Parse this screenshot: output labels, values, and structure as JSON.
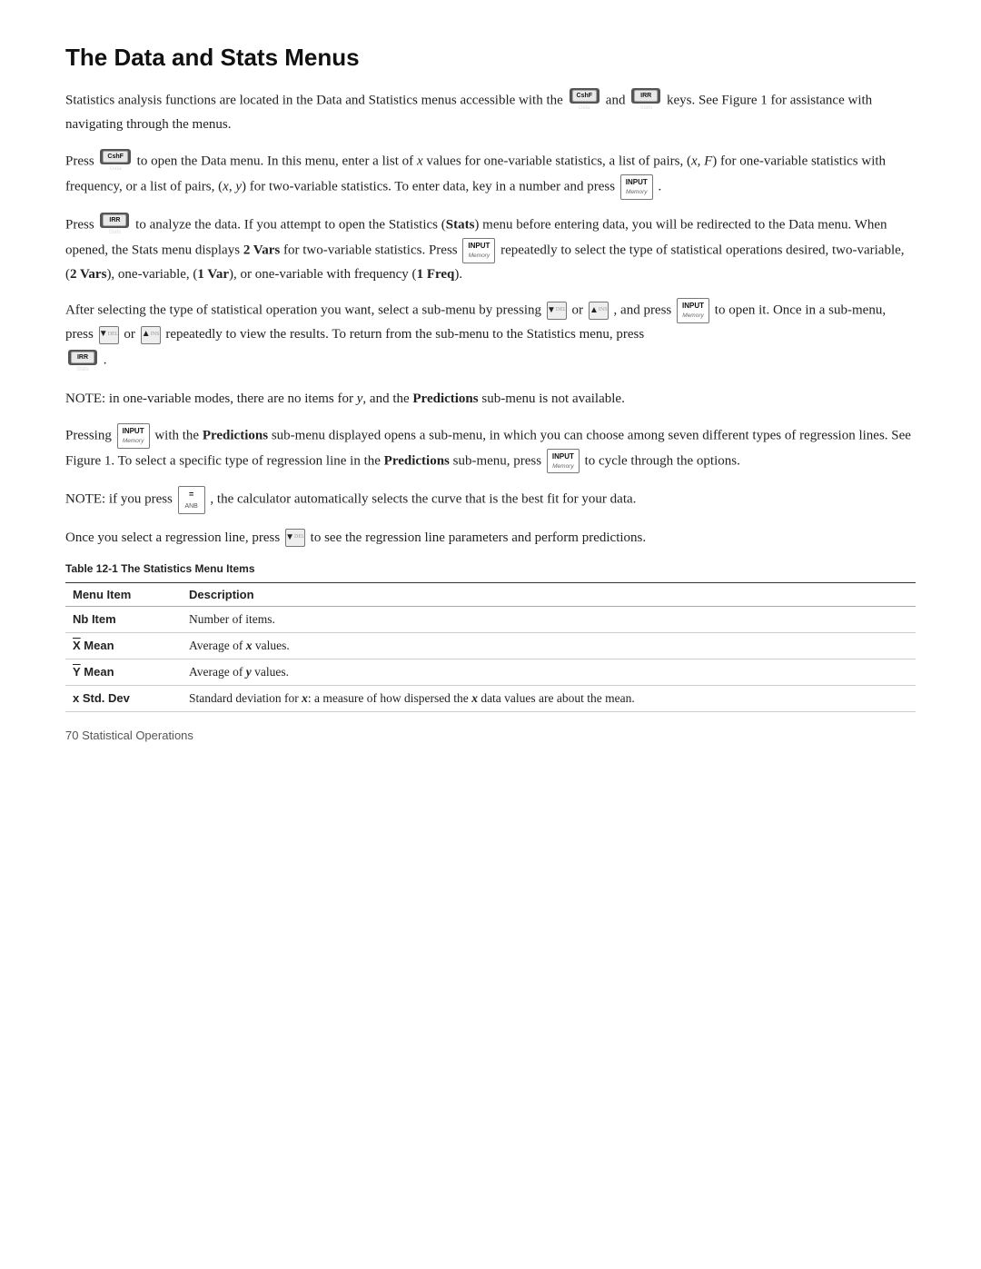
{
  "page": {
    "title": "The Data and Stats Menus",
    "paragraphs": [
      {
        "id": "p1",
        "text": "Statistics analysis functions are located in the Data and Statistics menus accessible with the"
      },
      {
        "id": "p1b",
        "text": "keys. See Figure 1 for assistance with navigating through the menus."
      },
      {
        "id": "p2a",
        "text": "Press"
      },
      {
        "id": "p2b",
        "text": "to open the Data menu. In this menu, enter a list of"
      },
      {
        "id": "p2c",
        "text": "values for one-variable statistics, a list of pairs, ("
      },
      {
        "id": "p2d",
        "text": ") for one-variable statistics with frequency, or a list of pairs, ("
      },
      {
        "id": "p2e",
        "text": ") for two-variable statistics. To enter data, key in a number and press"
      },
      {
        "id": "p3a",
        "text": "Press"
      },
      {
        "id": "p3b",
        "text": "to analyze the data. If you attempt to open the Statistics (Stats) menu before entering data, you will be redirected to the Data menu. When opened, the Stats menu displays 2 Vars for two-variable statistics. Press"
      },
      {
        "id": "p3c",
        "text": "repeatedly to select the type of statistical operations desired, two-variable, (2 Vars), one-variable, (1 Var), or one-variable with frequency (1 Freq)."
      },
      {
        "id": "p4a",
        "text": "After selecting the type of statistical operation you want, select a sub-menu by pressing"
      },
      {
        "id": "p4b",
        "text": "or"
      },
      {
        "id": "p4c",
        "text": ", and press"
      },
      {
        "id": "p4d",
        "text": "to open it. Once in a sub-menu, press"
      },
      {
        "id": "p4e",
        "text": "or"
      },
      {
        "id": "p4f",
        "text": "repeatedly to view the results. To return from the sub-menu to the Statistics menu, press"
      },
      {
        "id": "p5",
        "text": "NOTE:  in one-variable modes, there are no items for y, and the Predictions sub-menu is not available."
      },
      {
        "id": "p6a",
        "text": "Pressing"
      },
      {
        "id": "p6b",
        "text": "with the Predictions sub-menu displayed opens a sub-menu, in which you can choose among seven different types of regression lines. See Figure 1. To select a specific type of regression line in the Predictions sub-menu, press"
      },
      {
        "id": "p6c",
        "text": "to cycle through the options."
      },
      {
        "id": "p7a",
        "text": "NOTE:  if you press"
      },
      {
        "id": "p7b",
        "text": ", the calculator automatically selects the curve that is the best fit for your data."
      },
      {
        "id": "p8a",
        "text": "Once you select a regression line, press"
      },
      {
        "id": "p8b",
        "text": "to see the regression line parameters and perform predictions."
      }
    ],
    "table": {
      "caption": "Table 12-1  The Statistics Menu Items",
      "headers": [
        "Menu Item",
        "Description"
      ],
      "rows": [
        {
          "item": "Nb Item",
          "description": "Number of items."
        },
        {
          "item": "X̄ Mean",
          "description": "Average of x values."
        },
        {
          "item": "Ȳ Mean",
          "description": "Average of y values."
        },
        {
          "item": "x Std. Dev",
          "description": "Standard deviation for x: a measure of how dispersed the x data values are about the mean."
        }
      ]
    },
    "footer": "70   Statistical Operations"
  }
}
